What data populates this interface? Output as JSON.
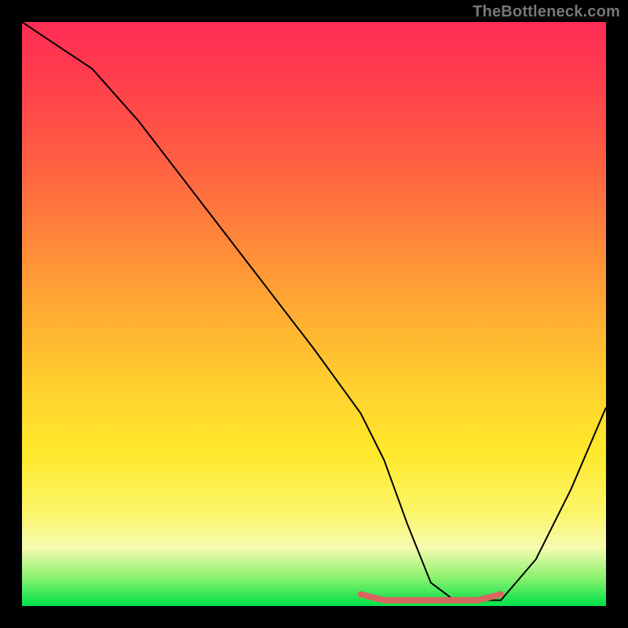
{
  "watermark": "TheBottleneck.com",
  "chart_data": {
    "type": "line",
    "title": "",
    "xlabel": "",
    "ylabel": "",
    "xlim": [
      0,
      100
    ],
    "ylim": [
      0,
      100
    ],
    "series": [
      {
        "name": "bottleneck-curve",
        "x": [
          0,
          6,
          12,
          20,
          30,
          40,
          50,
          58,
          62,
          66,
          70,
          74,
          78,
          82,
          88,
          94,
          100
        ],
        "y": [
          100,
          96,
          92,
          83,
          70,
          57,
          44,
          33,
          25,
          14,
          4,
          1,
          1,
          1,
          8,
          20,
          34
        ]
      },
      {
        "name": "bottom-highlight",
        "x": [
          58,
          62,
          66,
          70,
          74,
          78,
          82
        ],
        "y": [
          2,
          1,
          1,
          1,
          1,
          1,
          2
        ]
      }
    ],
    "colors": {
      "curve": "#000000",
      "highlight": "#d9675f"
    }
  }
}
